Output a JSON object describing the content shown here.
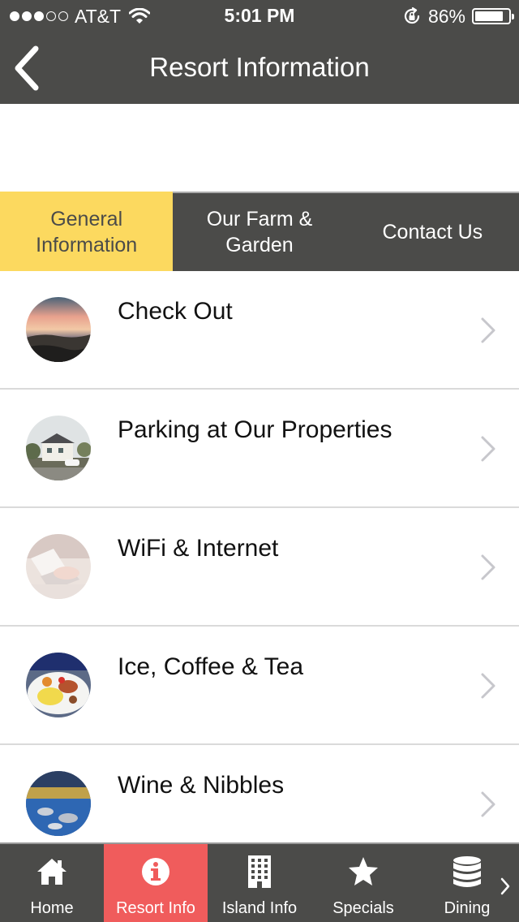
{
  "status_bar": {
    "carrier": "AT&T",
    "time": "5:01 PM",
    "battery": "86%",
    "battery_level": 0.86,
    "signal_bars_filled": 3,
    "signal_bars_total": 5
  },
  "nav": {
    "title": "Resort Information",
    "back_icon": "chevron-left-icon"
  },
  "tabs": [
    {
      "label": "General Information",
      "active": true
    },
    {
      "label": "Our Farm & Garden",
      "active": false
    },
    {
      "label": "Contact Us",
      "active": false
    }
  ],
  "list": {
    "items": [
      {
        "label": "Check Out",
        "thumb": "sunset-lake-photo"
      },
      {
        "label": "Parking at Our Properties",
        "thumb": "house-parking-photo"
      },
      {
        "label": "WiFi & Internet",
        "thumb": "laptop-photo"
      },
      {
        "label": "Ice, Coffee & Tea",
        "thumb": "breakfast-plate-photo"
      },
      {
        "label": "Wine & Nibbles",
        "thumb": "outdoor-buffet-photo"
      }
    ],
    "chevron_icon": "chevron-right-icon"
  },
  "tabbar": {
    "items": [
      {
        "label": "Home",
        "icon": "home-icon",
        "active": false
      },
      {
        "label": "Resort Info",
        "icon": "info-icon",
        "active": true
      },
      {
        "label": "Island Info",
        "icon": "building-icon",
        "active": false
      },
      {
        "label": "Specials",
        "icon": "star-icon",
        "active": false
      },
      {
        "label": "Dining",
        "icon": "database-icon",
        "active": false
      }
    ],
    "more_icon": "chevron-right-icon"
  },
  "colors": {
    "bar_background": "#4b4b49",
    "active_tab": "#fcd95f",
    "active_tabbar_item": "#f05c5c",
    "divider": "#dadada"
  }
}
